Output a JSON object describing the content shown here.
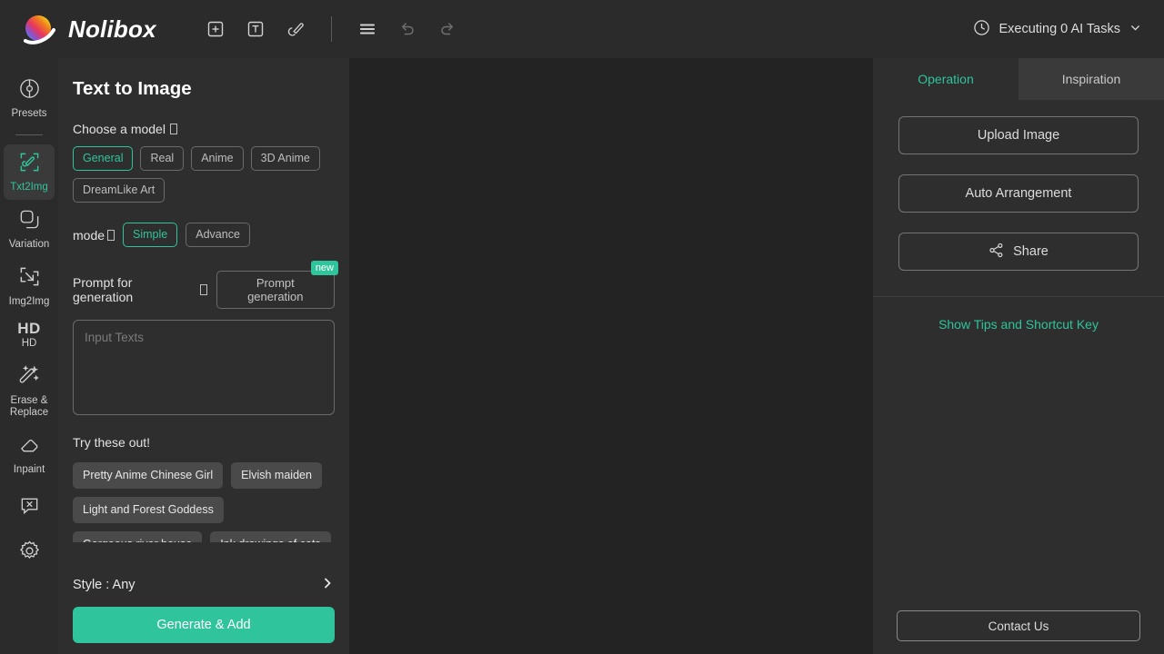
{
  "header": {
    "brand": "Nolibox",
    "tools": [
      {
        "name": "add-element-button",
        "icon": "plus-square-icon"
      },
      {
        "name": "add-text-button",
        "icon": "text-square-icon"
      },
      {
        "name": "brush-button",
        "icon": "brush-icon"
      }
    ],
    "menu_icon": "hamburger-menu-icon",
    "undo_icon": "undo-icon",
    "redo_icon": "redo-icon",
    "tasks_label": "Executing 0 AI Tasks",
    "tasks_icon": "clock-icon",
    "tasks_chevron": "chevron-down-icon"
  },
  "rail": {
    "items": [
      {
        "label": "Presets",
        "icon": "presets-icon",
        "active": false
      },
      {
        "label": "Txt2Img",
        "icon": "txt2img-icon",
        "active": true
      },
      {
        "label": "Variation",
        "icon": "variation-icon",
        "active": false
      },
      {
        "label": "Img2Img",
        "icon": "img2img-icon",
        "active": false
      },
      {
        "label": "HD",
        "icon": "hd-icon",
        "active": false
      },
      {
        "label": "Erase & Replace",
        "icon": "magic-wand-icon",
        "active": false
      },
      {
        "label": "Inpaint",
        "icon": "eraser-icon",
        "active": false
      }
    ],
    "extra_icons": [
      {
        "name": "feedback-bubble-icon"
      },
      {
        "name": "gear-icon"
      }
    ]
  },
  "panel": {
    "title": "Text to Image",
    "model_label": "Choose a model",
    "models": [
      {
        "label": "General",
        "selected": true
      },
      {
        "label": "Real",
        "selected": false
      },
      {
        "label": "Anime",
        "selected": false
      },
      {
        "label": "3D Anime",
        "selected": false
      },
      {
        "label": "DreamLike Art",
        "selected": false
      }
    ],
    "mode_label": "mode",
    "modes": [
      {
        "label": "Simple",
        "selected": true
      },
      {
        "label": "Advance",
        "selected": false
      }
    ],
    "prompt_label": "Prompt for generation",
    "prompt_generation_button": "Prompt generation",
    "new_badge": "new",
    "prompt_placeholder": "Input Texts",
    "prompt_value": "",
    "try_title": "Try these out!",
    "suggestions": [
      "Pretty Anime Chinese Girl",
      "Elvish maiden",
      "Light and Forest Goddess",
      "Gorgeous river house",
      "Ink drawings of cats"
    ],
    "style_row": "Style : Any",
    "style_chevron": "chevron-right-icon",
    "generate_button": "Generate & Add"
  },
  "right": {
    "tabs": [
      {
        "label": "Operation",
        "active": true
      },
      {
        "label": "Inspiration",
        "active": false
      }
    ],
    "buttons": [
      {
        "label": "Upload Image",
        "icon": null
      },
      {
        "label": "Auto Arrangement",
        "icon": null
      },
      {
        "label": "Share",
        "icon": "share-icon"
      }
    ],
    "tips_link": "Show Tips and Shortcut Key",
    "contact_button": "Contact Us"
  },
  "colors": {
    "accent": "#2fc49b",
    "panel_bg": "#2e2e2e",
    "canvas_bg": "#232323",
    "header_bg": "#2b2b2b"
  }
}
